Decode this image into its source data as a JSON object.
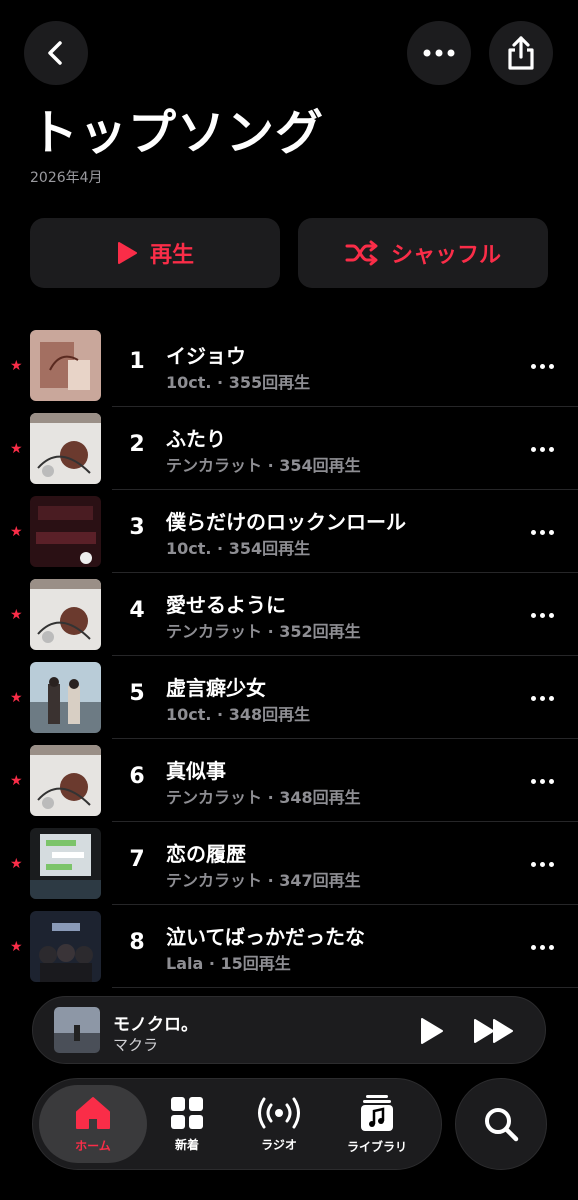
{
  "header": {
    "title": "トップソング",
    "subtitle": "2026年4月"
  },
  "actions": {
    "play_label": "再生",
    "shuffle_label": "シャッフル"
  },
  "icons": {
    "back": "chevron-left-icon",
    "more": "ellipsis-icon",
    "share": "share-icon",
    "play": "play-icon",
    "shuffle": "shuffle-icon",
    "favorite": "star-icon"
  },
  "colors": {
    "accent": "#fa2d48",
    "background": "#000000",
    "surface": "#1c1c1e",
    "secondary_text": "#8e8e93"
  },
  "songs": [
    {
      "rank": "1",
      "title": "イジョウ",
      "meta": "10ct. · 355回再生"
    },
    {
      "rank": "2",
      "title": "ふたり",
      "meta": "テンカラット · 354回再生"
    },
    {
      "rank": "3",
      "title": "僕らだけのロックンロール",
      "meta": "10ct. · 354回再生"
    },
    {
      "rank": "4",
      "title": "愛せるように",
      "meta": "テンカラット · 352回再生"
    },
    {
      "rank": "5",
      "title": "虚言癖少女",
      "meta": "10ct. · 348回再生"
    },
    {
      "rank": "6",
      "title": "真似事",
      "meta": "テンカラット · 348回再生"
    },
    {
      "rank": "7",
      "title": "恋の履歴",
      "meta": "テンカラット · 347回再生"
    },
    {
      "rank": "8",
      "title": "泣いてばっかだったな",
      "meta": "Lala · 15回再生"
    }
  ],
  "now_playing": {
    "title": "モノクロ。",
    "artist": "マクラ"
  },
  "tabs": [
    {
      "label": "ホーム",
      "icon": "home-icon",
      "active": true
    },
    {
      "label": "新着",
      "icon": "grid-icon",
      "active": false
    },
    {
      "label": "ラジオ",
      "icon": "radio-icon",
      "active": false
    },
    {
      "label": "ライブラリ",
      "icon": "library-icon",
      "active": false
    }
  ],
  "search": {
    "icon": "search-icon"
  }
}
